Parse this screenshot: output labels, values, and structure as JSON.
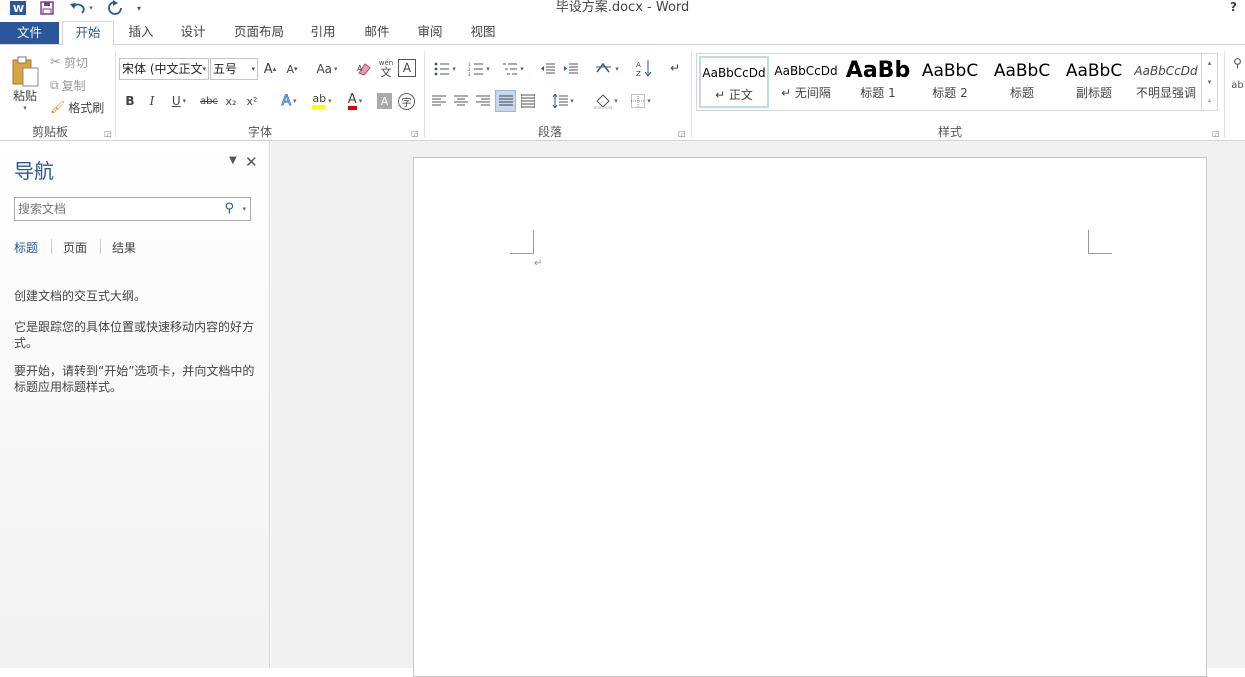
{
  "titlebar": {
    "title": "毕设方案.docx - Word",
    "help": "?",
    "icons": [
      "word-app-icon",
      "save-icon",
      "undo-icon",
      "redo-icon",
      "customize-qat-icon"
    ]
  },
  "tabs": [
    {
      "label": "文件",
      "active": false
    },
    {
      "label": "开始",
      "active": true
    },
    {
      "label": "插入",
      "active": false
    },
    {
      "label": "设计",
      "active": false
    },
    {
      "label": "页面布局",
      "active": false
    },
    {
      "label": "引用",
      "active": false
    },
    {
      "label": "邮件",
      "active": false
    },
    {
      "label": "审阅",
      "active": false
    },
    {
      "label": "视图",
      "active": false
    }
  ],
  "ribbon": {
    "clipboard": {
      "paste": "粘贴",
      "cut": "剪切",
      "copy": "复制",
      "format_painter": "格式刷",
      "label": "剪贴板"
    },
    "font": {
      "font_name": "宋体 (中文正文",
      "font_size": "五号",
      "grow": "A",
      "shrink": "A",
      "change_case": "Aa",
      "bold": "B",
      "italic": "I",
      "underline": "U",
      "strikethrough": "abc",
      "subscript": "x₂",
      "superscript": "x²",
      "text_effects": "A",
      "font_color": "A",
      "char_shading": "A",
      "label": "字体"
    },
    "paragraph": {
      "label": "段落"
    },
    "styles": {
      "label": "样式",
      "items": [
        {
          "preview": "AaBbCcDd",
          "name": "↵ 正文",
          "selected": true
        },
        {
          "preview": "AaBbCcDd",
          "name": "↵ 无间隔",
          "selected": false
        },
        {
          "preview": "AaBb",
          "name": "标题 1",
          "selected": false
        },
        {
          "preview": "AaBbC",
          "name": "标题 2",
          "selected": false
        },
        {
          "preview": "AaBbC",
          "name": "标题",
          "selected": false
        },
        {
          "preview": "AaBbC",
          "name": "副标题",
          "selected": false
        },
        {
          "preview": "AaBbCcDd",
          "name": "不明显强调",
          "selected": false
        }
      ]
    }
  },
  "navigation": {
    "title": "导航",
    "search_placeholder": "搜索文档",
    "tabs": [
      "标题",
      "页面",
      "结果"
    ],
    "active_tab": "标题",
    "text1": "创建文档的交互式大纲。",
    "text2": "它是跟踪您的具体位置或快速移动内容的好方式。",
    "text3": "要开始，请转到“开始”选项卡，并向文档中的标题应用标题样式。"
  },
  "colors": {
    "accent": "#2b579a",
    "highlight": "#ffff00",
    "font_color": "#e00000"
  }
}
